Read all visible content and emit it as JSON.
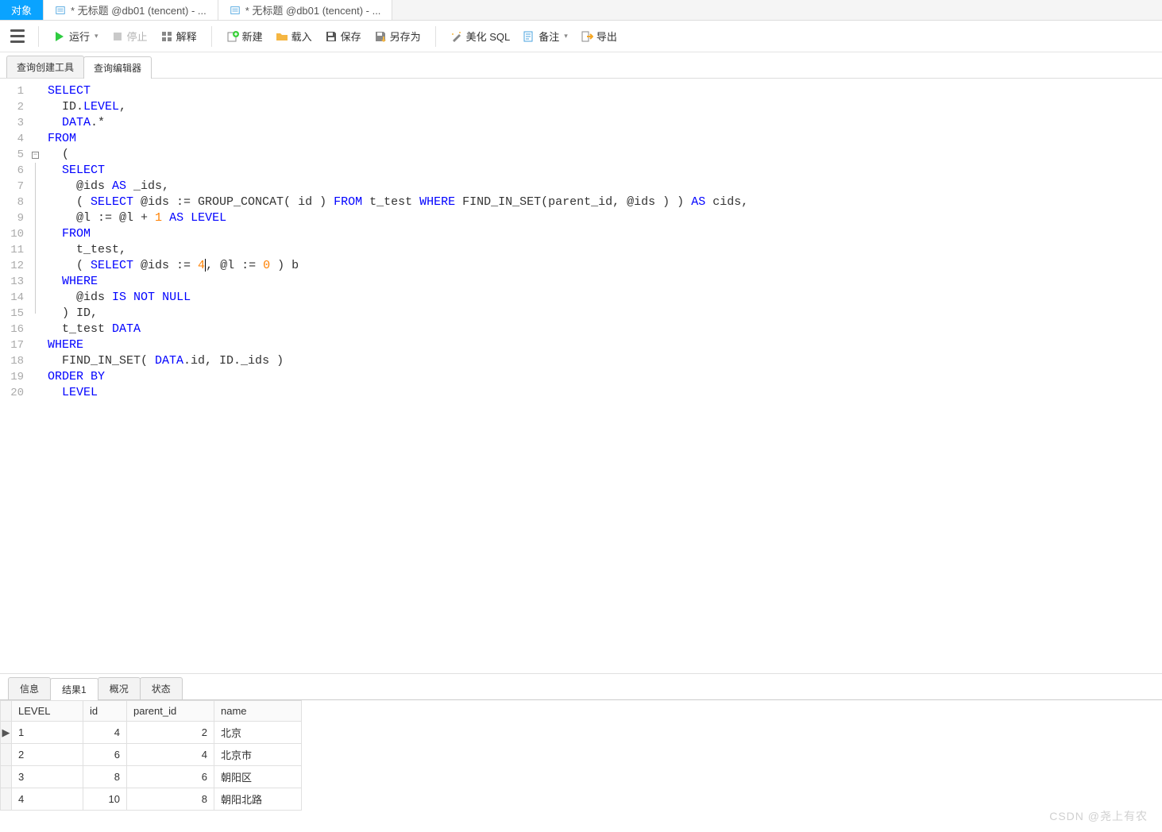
{
  "top_tabs": [
    {
      "label": "对象",
      "active": true
    },
    {
      "label": "* 无标题 @db01 (tencent) - ...",
      "active": false
    },
    {
      "label": "* 无标题 @db01 (tencent) - ...",
      "active": false
    }
  ],
  "toolbar": {
    "run": "运行",
    "stop": "停止",
    "explain": "解释",
    "new": "新建",
    "load": "载入",
    "save": "保存",
    "saveas": "另存为",
    "beautify": "美化 SQL",
    "notes": "备注",
    "export": "导出"
  },
  "sub_tabs": {
    "builder": "查询创建工具",
    "editor": "查询编辑器",
    "active": "editor"
  },
  "code_lines": [
    {
      "n": 1,
      "html": "<span class='kw'>SELECT</span>"
    },
    {
      "n": 2,
      "html": "  ID.<span class='kw'>LEVEL</span>,"
    },
    {
      "n": 3,
      "html": "  <span class='kw'>DATA</span>.*"
    },
    {
      "n": 4,
      "html": "<span class='kw'>FROM</span>"
    },
    {
      "n": 5,
      "fold": "start",
      "html": "  ("
    },
    {
      "n": 6,
      "fold": "mid",
      "html": "  <span class='kw'>SELECT</span>"
    },
    {
      "n": 7,
      "fold": "mid",
      "html": "    @ids <span class='kw'>AS</span> _ids,"
    },
    {
      "n": 8,
      "fold": "mid",
      "html": "    ( <span class='kw'>SELECT</span> @ids := GROUP_CONCAT( id ) <span class='kw'>FROM</span> t_test <span class='kw'>WHERE</span> FIND_IN_SET(parent_id, @ids ) ) <span class='kw'>AS</span> cids,"
    },
    {
      "n": 9,
      "fold": "mid",
      "html": "    @l := @l + <span class='num'>1</span> <span class='kw'>AS</span> <span class='kw'>LEVEL</span>"
    },
    {
      "n": 10,
      "fold": "mid",
      "html": "  <span class='kw'>FROM</span>"
    },
    {
      "n": 11,
      "fold": "mid",
      "html": "    t_test,"
    },
    {
      "n": 12,
      "fold": "mid",
      "html": "    ( <span class='kw'>SELECT</span> @ids := <span class='num'>4</span><span class='caret-blink'></span>, @l := <span class='num'>0</span> ) b"
    },
    {
      "n": 13,
      "fold": "mid",
      "html": "  <span class='kw'>WHERE</span>"
    },
    {
      "n": 14,
      "fold": "mid",
      "html": "    @ids <span class='kw'>IS</span> <span class='kw'>NOT</span> <span class='kw'>NULL</span>"
    },
    {
      "n": 15,
      "fold": "end",
      "html": "  ) ID,"
    },
    {
      "n": 16,
      "html": "  t_test <span class='kw'>DATA</span>"
    },
    {
      "n": 17,
      "html": "<span class='kw'>WHERE</span>"
    },
    {
      "n": 18,
      "html": "  FIND_IN_SET( <span class='kw'>DATA</span>.id, ID._ids )"
    },
    {
      "n": 19,
      "html": "<span class='kw'>ORDER</span> <span class='kw'>BY</span>"
    },
    {
      "n": 20,
      "html": "  <span class='kw'>LEVEL</span>"
    }
  ],
  "result_tabs": {
    "info": "信息",
    "res1": "结果1",
    "profile": "概况",
    "status": "状态",
    "active": "res1"
  },
  "result_columns": [
    "LEVEL",
    "id",
    "parent_id",
    "name"
  ],
  "result_rows": [
    {
      "current": true,
      "cells": [
        "1",
        "4",
        "2",
        "北京"
      ]
    },
    {
      "current": false,
      "cells": [
        "2",
        "6",
        "4",
        "北京市"
      ]
    },
    {
      "current": false,
      "cells": [
        "3",
        "8",
        "6",
        "朝阳区"
      ]
    },
    {
      "current": false,
      "cells": [
        "4",
        "10",
        "8",
        "朝阳北路"
      ]
    }
  ],
  "watermark": "CSDN @尧上有农"
}
